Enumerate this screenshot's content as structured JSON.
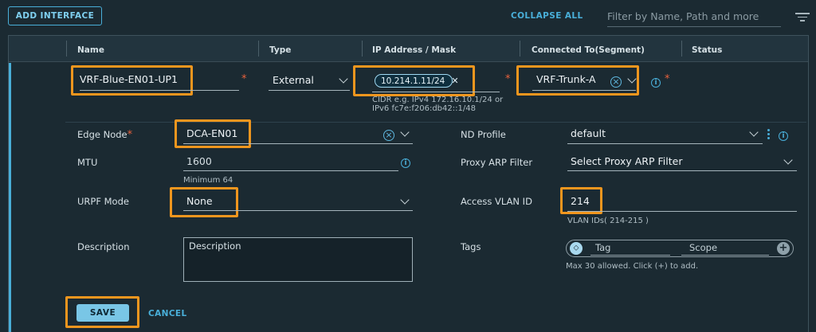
{
  "toolbar": {
    "add_interface": "ADD INTERFACE",
    "collapse_all": "COLLAPSE ALL",
    "filter_placeholder": "Filter by Name, Path and more"
  },
  "columns": [
    "Name",
    "Type",
    "IP Address / Mask",
    "Connected To(Segment)",
    "Status"
  ],
  "row": {
    "name": "VRF-Blue-EN01-UP1",
    "type": "External",
    "ip_chip": "10.214.1.11/24",
    "ip_hint_1": "CIDR e.g. IPv4 172.16.10.1/24 or",
    "ip_hint_2": "IPv6 fc7e:f206:db42::1/48",
    "segment": "VRF-Trunk-A",
    "required_mark": "*"
  },
  "form": {
    "edge_node_label": "Edge Node",
    "edge_node_value": "DCA-EN01",
    "mtu_label": "MTU",
    "mtu_value": "1600",
    "mtu_hint": "Minimum 64",
    "urpf_label": "URPF Mode",
    "urpf_value": "None",
    "description_label": "Description",
    "description_placeholder": "Description",
    "nd_profile_label": "ND Profile",
    "nd_profile_value": "default",
    "proxy_arp_label": "Proxy ARP Filter",
    "proxy_arp_value": "Select Proxy ARP Filter",
    "access_vlan_label": "Access VLAN ID",
    "access_vlan_value": "214",
    "vlan_hint": "VLAN IDs( 214-215 )",
    "tags_label": "Tags",
    "tag_placeholder": "Tag",
    "scope_placeholder": "Scope",
    "tags_hint": "Max 30 allowed. Click (+) to add."
  },
  "actions": {
    "save": "SAVE",
    "cancel": "CANCEL"
  },
  "colors": {
    "accent": "#49afd9",
    "highlight": "#f0961e",
    "background": "#1b2a32"
  }
}
